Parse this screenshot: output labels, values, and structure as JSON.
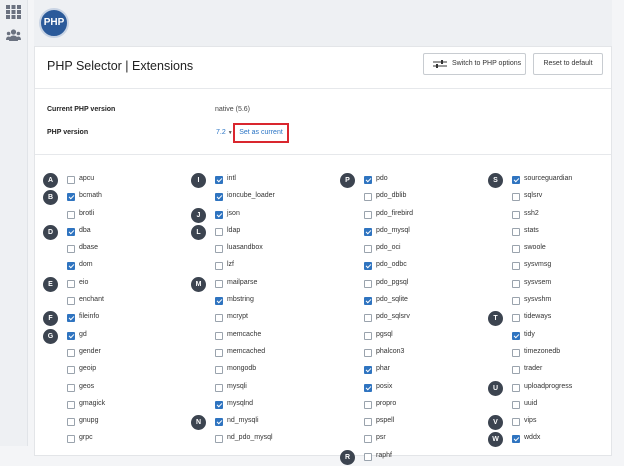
{
  "rail": {
    "icons": [
      "grid-icon",
      "users-icon"
    ]
  },
  "header": {
    "logo_text": "PHP"
  },
  "page": {
    "title": "PHP Selector | Extensions",
    "switch_button": "Switch to PHP options",
    "reset_button": "Reset to default"
  },
  "versions": {
    "current_label": "Current PHP version",
    "current_value": "native (5.6)",
    "php_label": "PHP version",
    "selected": "7.2",
    "set_current": "Set as current"
  },
  "columns": [
    [
      {
        "letter": "A",
        "name": "apcu",
        "checked": false
      },
      {
        "letter": "B",
        "name": "bcmath",
        "checked": true
      },
      {
        "letter": "",
        "name": "brotli",
        "checked": false
      },
      {
        "letter": "D",
        "name": "dba",
        "checked": true
      },
      {
        "letter": "",
        "name": "dbase",
        "checked": false
      },
      {
        "letter": "",
        "name": "dom",
        "checked": true
      },
      {
        "letter": "E",
        "name": "eio",
        "checked": false
      },
      {
        "letter": "",
        "name": "enchant",
        "checked": false
      },
      {
        "letter": "F",
        "name": "fileinfo",
        "checked": true
      },
      {
        "letter": "G",
        "name": "gd",
        "checked": true
      },
      {
        "letter": "",
        "name": "gender",
        "checked": false
      },
      {
        "letter": "",
        "name": "geoip",
        "checked": false
      },
      {
        "letter": "",
        "name": "geos",
        "checked": false
      },
      {
        "letter": "",
        "name": "gmagick",
        "checked": false
      },
      {
        "letter": "",
        "name": "gnupg",
        "checked": false
      },
      {
        "letter": "",
        "name": "grpc",
        "checked": false
      }
    ],
    [
      {
        "letter": "I",
        "name": "intl",
        "checked": true
      },
      {
        "letter": "",
        "name": "ioncube_loader",
        "checked": true
      },
      {
        "letter": "J",
        "name": "json",
        "checked": true
      },
      {
        "letter": "L",
        "name": "ldap",
        "checked": false
      },
      {
        "letter": "",
        "name": "luasandbox",
        "checked": false
      },
      {
        "letter": "",
        "name": "lzf",
        "checked": false
      },
      {
        "letter": "M",
        "name": "mailparse",
        "checked": false
      },
      {
        "letter": "",
        "name": "mbstring",
        "checked": true
      },
      {
        "letter": "",
        "name": "mcrypt",
        "checked": false
      },
      {
        "letter": "",
        "name": "memcache",
        "checked": false
      },
      {
        "letter": "",
        "name": "memcached",
        "checked": false
      },
      {
        "letter": "",
        "name": "mongodb",
        "checked": false
      },
      {
        "letter": "",
        "name": "mysqli",
        "checked": false
      },
      {
        "letter": "",
        "name": "mysqlnd",
        "checked": true
      },
      {
        "letter": "N",
        "name": "nd_mysqli",
        "checked": true
      },
      {
        "letter": "",
        "name": "nd_pdo_mysql",
        "checked": false
      }
    ],
    [
      {
        "letter": "P",
        "name": "pdo",
        "checked": true
      },
      {
        "letter": "",
        "name": "pdo_dblib",
        "checked": false
      },
      {
        "letter": "",
        "name": "pdo_firebird",
        "checked": false
      },
      {
        "letter": "",
        "name": "pdo_mysql",
        "checked": true
      },
      {
        "letter": "",
        "name": "pdo_oci",
        "checked": false
      },
      {
        "letter": "",
        "name": "pdo_odbc",
        "checked": true
      },
      {
        "letter": "",
        "name": "pdo_pgsql",
        "checked": false
      },
      {
        "letter": "",
        "name": "pdo_sqlite",
        "checked": true
      },
      {
        "letter": "",
        "name": "pdo_sqlsrv",
        "checked": false
      },
      {
        "letter": "",
        "name": "pgsql",
        "checked": false
      },
      {
        "letter": "",
        "name": "phalcon3",
        "checked": false
      },
      {
        "letter": "",
        "name": "phar",
        "checked": true
      },
      {
        "letter": "",
        "name": "posix",
        "checked": true
      },
      {
        "letter": "",
        "name": "propro",
        "checked": false
      },
      {
        "letter": "",
        "name": "pspell",
        "checked": false
      },
      {
        "letter": "",
        "name": "psr",
        "checked": false
      },
      {
        "letter": "R",
        "name": "raphf",
        "checked": false
      }
    ],
    [
      {
        "letter": "S",
        "name": "sourceguardian",
        "checked": true
      },
      {
        "letter": "",
        "name": "sqlsrv",
        "checked": false
      },
      {
        "letter": "",
        "name": "ssh2",
        "checked": false
      },
      {
        "letter": "",
        "name": "stats",
        "checked": false
      },
      {
        "letter": "",
        "name": "swoole",
        "checked": false
      },
      {
        "letter": "",
        "name": "sysvmsg",
        "checked": false
      },
      {
        "letter": "",
        "name": "sysvsem",
        "checked": false
      },
      {
        "letter": "",
        "name": "sysvshm",
        "checked": false
      },
      {
        "letter": "T",
        "name": "tideways",
        "checked": false
      },
      {
        "letter": "",
        "name": "tidy",
        "checked": true
      },
      {
        "letter": "",
        "name": "timezonedb",
        "checked": false
      },
      {
        "letter": "",
        "name": "trader",
        "checked": false
      },
      {
        "letter": "U",
        "name": "uploadprogress",
        "checked": false
      },
      {
        "letter": "",
        "name": "uuid",
        "checked": false
      },
      {
        "letter": "V",
        "name": "vips",
        "checked": false
      },
      {
        "letter": "W",
        "name": "wddx",
        "checked": true
      }
    ]
  ],
  "colors": {
    "accent": "#2f74c0",
    "highlight": "#d9262e",
    "letter_badge": "#3c4450"
  }
}
